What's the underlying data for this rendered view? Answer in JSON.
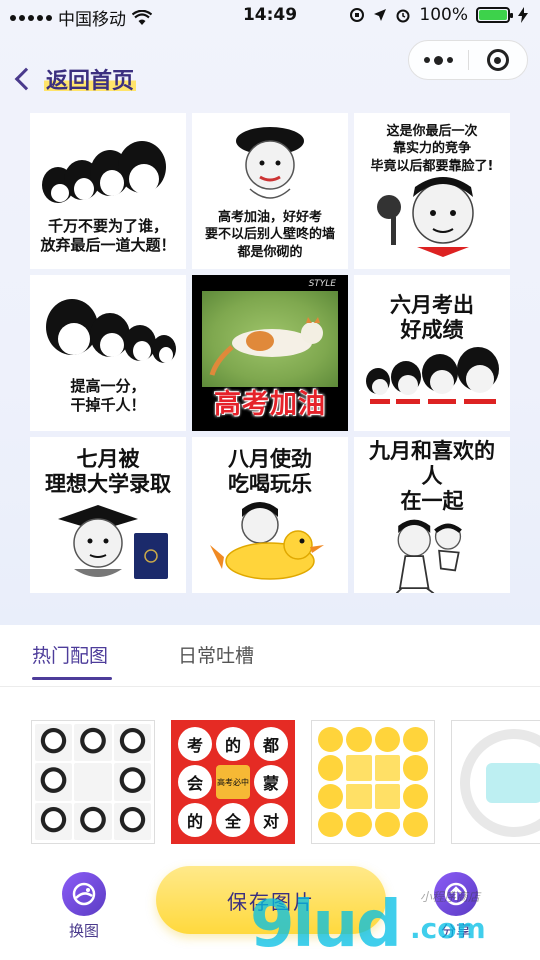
{
  "status_bar": {
    "carrier": "中国移动",
    "time": "14:49",
    "battery": "100%"
  },
  "nav": {
    "back_label": "返回首页"
  },
  "memes": [
    {
      "text": "千万不要为了谁，\n放弃最后一道大题！"
    },
    {
      "text": "高考加油，好好考\n要不以后别人壁咚的墙\n都是你砌的"
    },
    {
      "text": "这是你最后一次\n靠实力的竞争\n毕竟以后都要靠脸了!"
    },
    {
      "text": "提高一分，\n干掉千人！"
    },
    {
      "text": "高考加油",
      "tag": "STYLE"
    },
    {
      "text": "六月考出\n好成绩"
    },
    {
      "text": "七月被\n理想大学录取"
    },
    {
      "text": "八月使劲\n吃喝玩乐"
    },
    {
      "text": "九月和喜欢的人\n在一起"
    }
  ],
  "tabs": [
    {
      "label": "热门配图",
      "active": true
    },
    {
      "label": "日常吐槽",
      "active": false
    }
  ],
  "thumbnails": {
    "t2_chars": [
      "考",
      "的",
      "都",
      "会",
      "蒙",
      "的",
      "全",
      "对"
    ],
    "t2_center": "高考必中"
  },
  "bottom_bar": {
    "swap_label": "换图",
    "save_label": "保存图片",
    "share_label": "分享"
  },
  "watermark": {
    "main": "9lud",
    "suffix": ".com",
    "small": "小程序商店"
  },
  "colors": {
    "accent_purple": "#4d3c9a",
    "save_yellow": "#ffd93d",
    "highlight_yellow": "#ffe46b",
    "caption_red": "#e5222a"
  }
}
